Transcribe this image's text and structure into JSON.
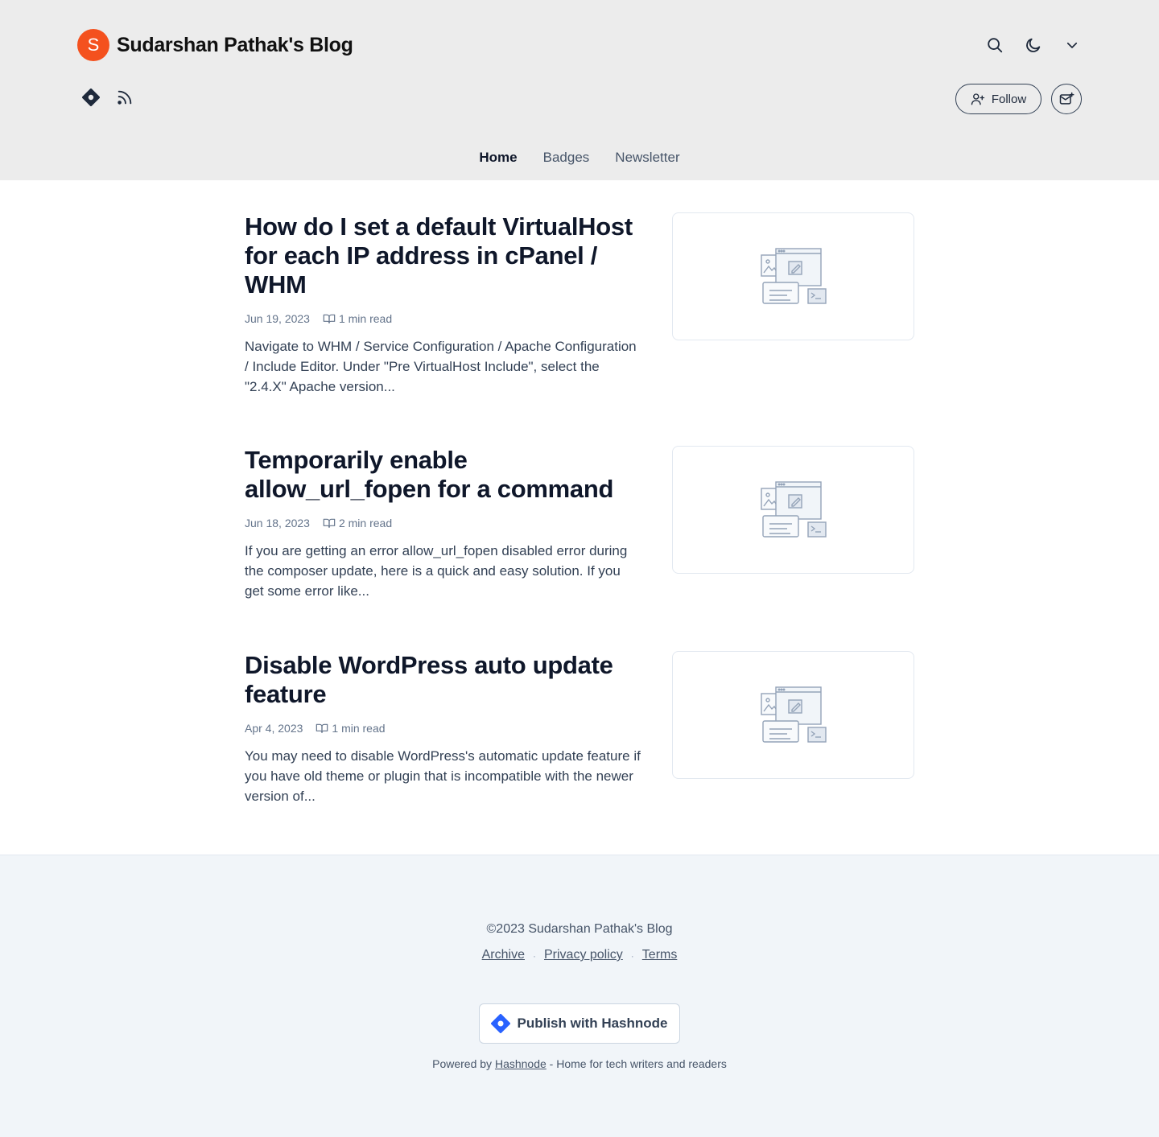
{
  "header": {
    "avatar_letter": "S",
    "blog_title": "Sudarshan Pathak's Blog",
    "follow_label": "Follow",
    "icons": [
      "search-icon",
      "moon-icon",
      "chevron-down-icon",
      "hashnode-icon",
      "rss-icon",
      "user-plus-icon",
      "newsletter-icon"
    ],
    "avatar_color": "#f4511e"
  },
  "nav": {
    "items": [
      {
        "label": "Home",
        "active": true
      },
      {
        "label": "Badges",
        "active": false
      },
      {
        "label": "Newsletter",
        "active": false
      }
    ]
  },
  "posts": [
    {
      "title": "How do I set a default VirtualHost for each IP address in cPanel / WHM",
      "date": "Jun 19, 2023",
      "read_time": "1 min read",
      "excerpt": "Navigate to WHM / Service Configuration / Apache Configuration / Include Editor. Under \"Pre VirtualHost Include\", select the \"2.4.X\" Apache version..."
    },
    {
      "title": "Temporarily enable allow_url_fopen for a command",
      "date": "Jun 18, 2023",
      "read_time": "2 min read",
      "excerpt": "If you are getting an error allow_url_fopen disabled error during the composer update, here is a quick and easy solution. If you get some error like..."
    },
    {
      "title": "Disable WordPress auto update feature",
      "date": "Apr 4, 2023",
      "read_time": "1 min read",
      "excerpt": "You may need to disable WordPress's automatic update feature if you have old theme or plugin that is incompatible with the newer version of..."
    }
  ],
  "footer": {
    "copyright": "©2023 Sudarshan Pathak's Blog",
    "links": [
      "Archive",
      "Privacy policy",
      "Terms"
    ],
    "separator": "·",
    "publish_label": "Publish with Hashnode",
    "powered_prefix": "Powered by",
    "powered_link": "Hashnode",
    "powered_suffix": "- Home for tech writers and readers"
  },
  "colors": {
    "header_bg": "#ececec",
    "footer_bg": "#f1f5f9",
    "hashnode_blue": "#2962ff"
  }
}
